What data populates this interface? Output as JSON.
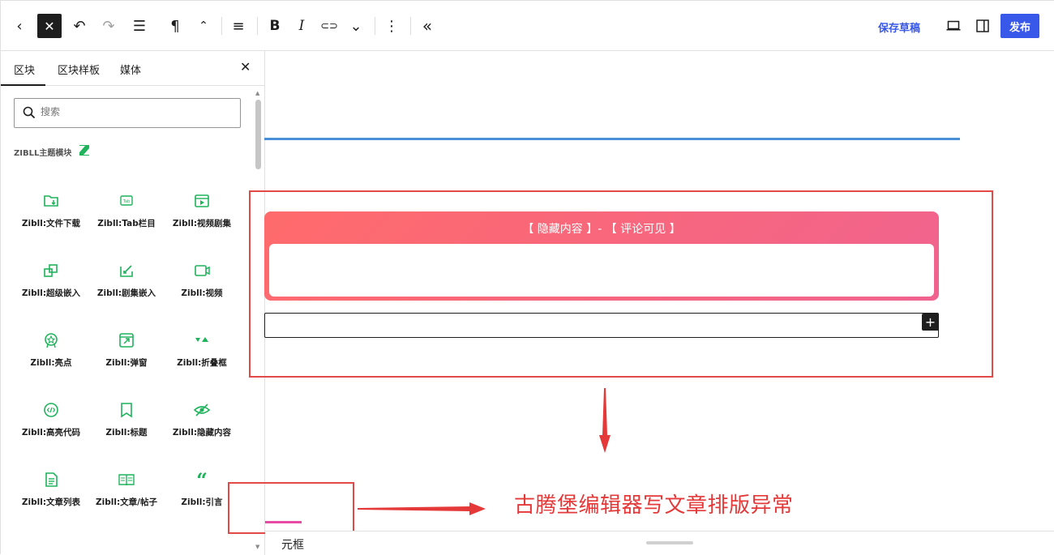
{
  "toolbar": {
    "back": "‹",
    "close": "✕",
    "undo": "↶",
    "redo": "↷",
    "list_view": "☰",
    "paragraph": "¶",
    "move": "⌃",
    "align": "≡",
    "bold": "B",
    "italic": "I",
    "link": "⊂⊃",
    "more_rich": "⌄",
    "options": "⋮",
    "collapse": "«",
    "save_draft": "保存草稿",
    "publish": "发布"
  },
  "sidebar": {
    "tabs": [
      "区块",
      "区块样板",
      "媒体"
    ],
    "close": "✕",
    "search_placeholder": "搜索",
    "category": "ZIBLL主题模块",
    "blocks": [
      {
        "label": "Zibll:文件下载",
        "icon": "folder-download-icon"
      },
      {
        "label": "Zibll:Tab栏目",
        "icon": "tab-icon"
      },
      {
        "label": "Zibll:视频剧集",
        "icon": "video-series-icon"
      },
      {
        "label": "Zibll:超级嵌入",
        "icon": "embed-icon"
      },
      {
        "label": "Zibll:剧集嵌入",
        "icon": "series-embed-icon"
      },
      {
        "label": "Zibll:视频",
        "icon": "video-icon"
      },
      {
        "label": "Zibll:亮点",
        "icon": "badge-icon"
      },
      {
        "label": "Zibll:弹窗",
        "icon": "popup-icon"
      },
      {
        "label": "Zibll:折叠框",
        "icon": "collapse-icon"
      },
      {
        "label": "Zibll:高亮代码",
        "icon": "code-icon"
      },
      {
        "label": "Zibll:标题",
        "icon": "bookmark-icon"
      },
      {
        "label": "Zibll:隐藏内容",
        "icon": "eye-slash-icon"
      },
      {
        "label": "Zibll:文章列表",
        "icon": "document-list-icon"
      },
      {
        "label": "Zibll:文章/帖子",
        "icon": "book-icon"
      },
      {
        "label": "Zibll:引言",
        "icon": "quote-icon"
      }
    ],
    "accent": "#1fb35b"
  },
  "canvas": {
    "hidden_title": "【 隐藏内容 】- 【 评论可见 】",
    "add_block": "+",
    "annotation": "古腾堡编辑器写文章排版异常"
  },
  "footer": {
    "breadcrumb": "元框"
  }
}
